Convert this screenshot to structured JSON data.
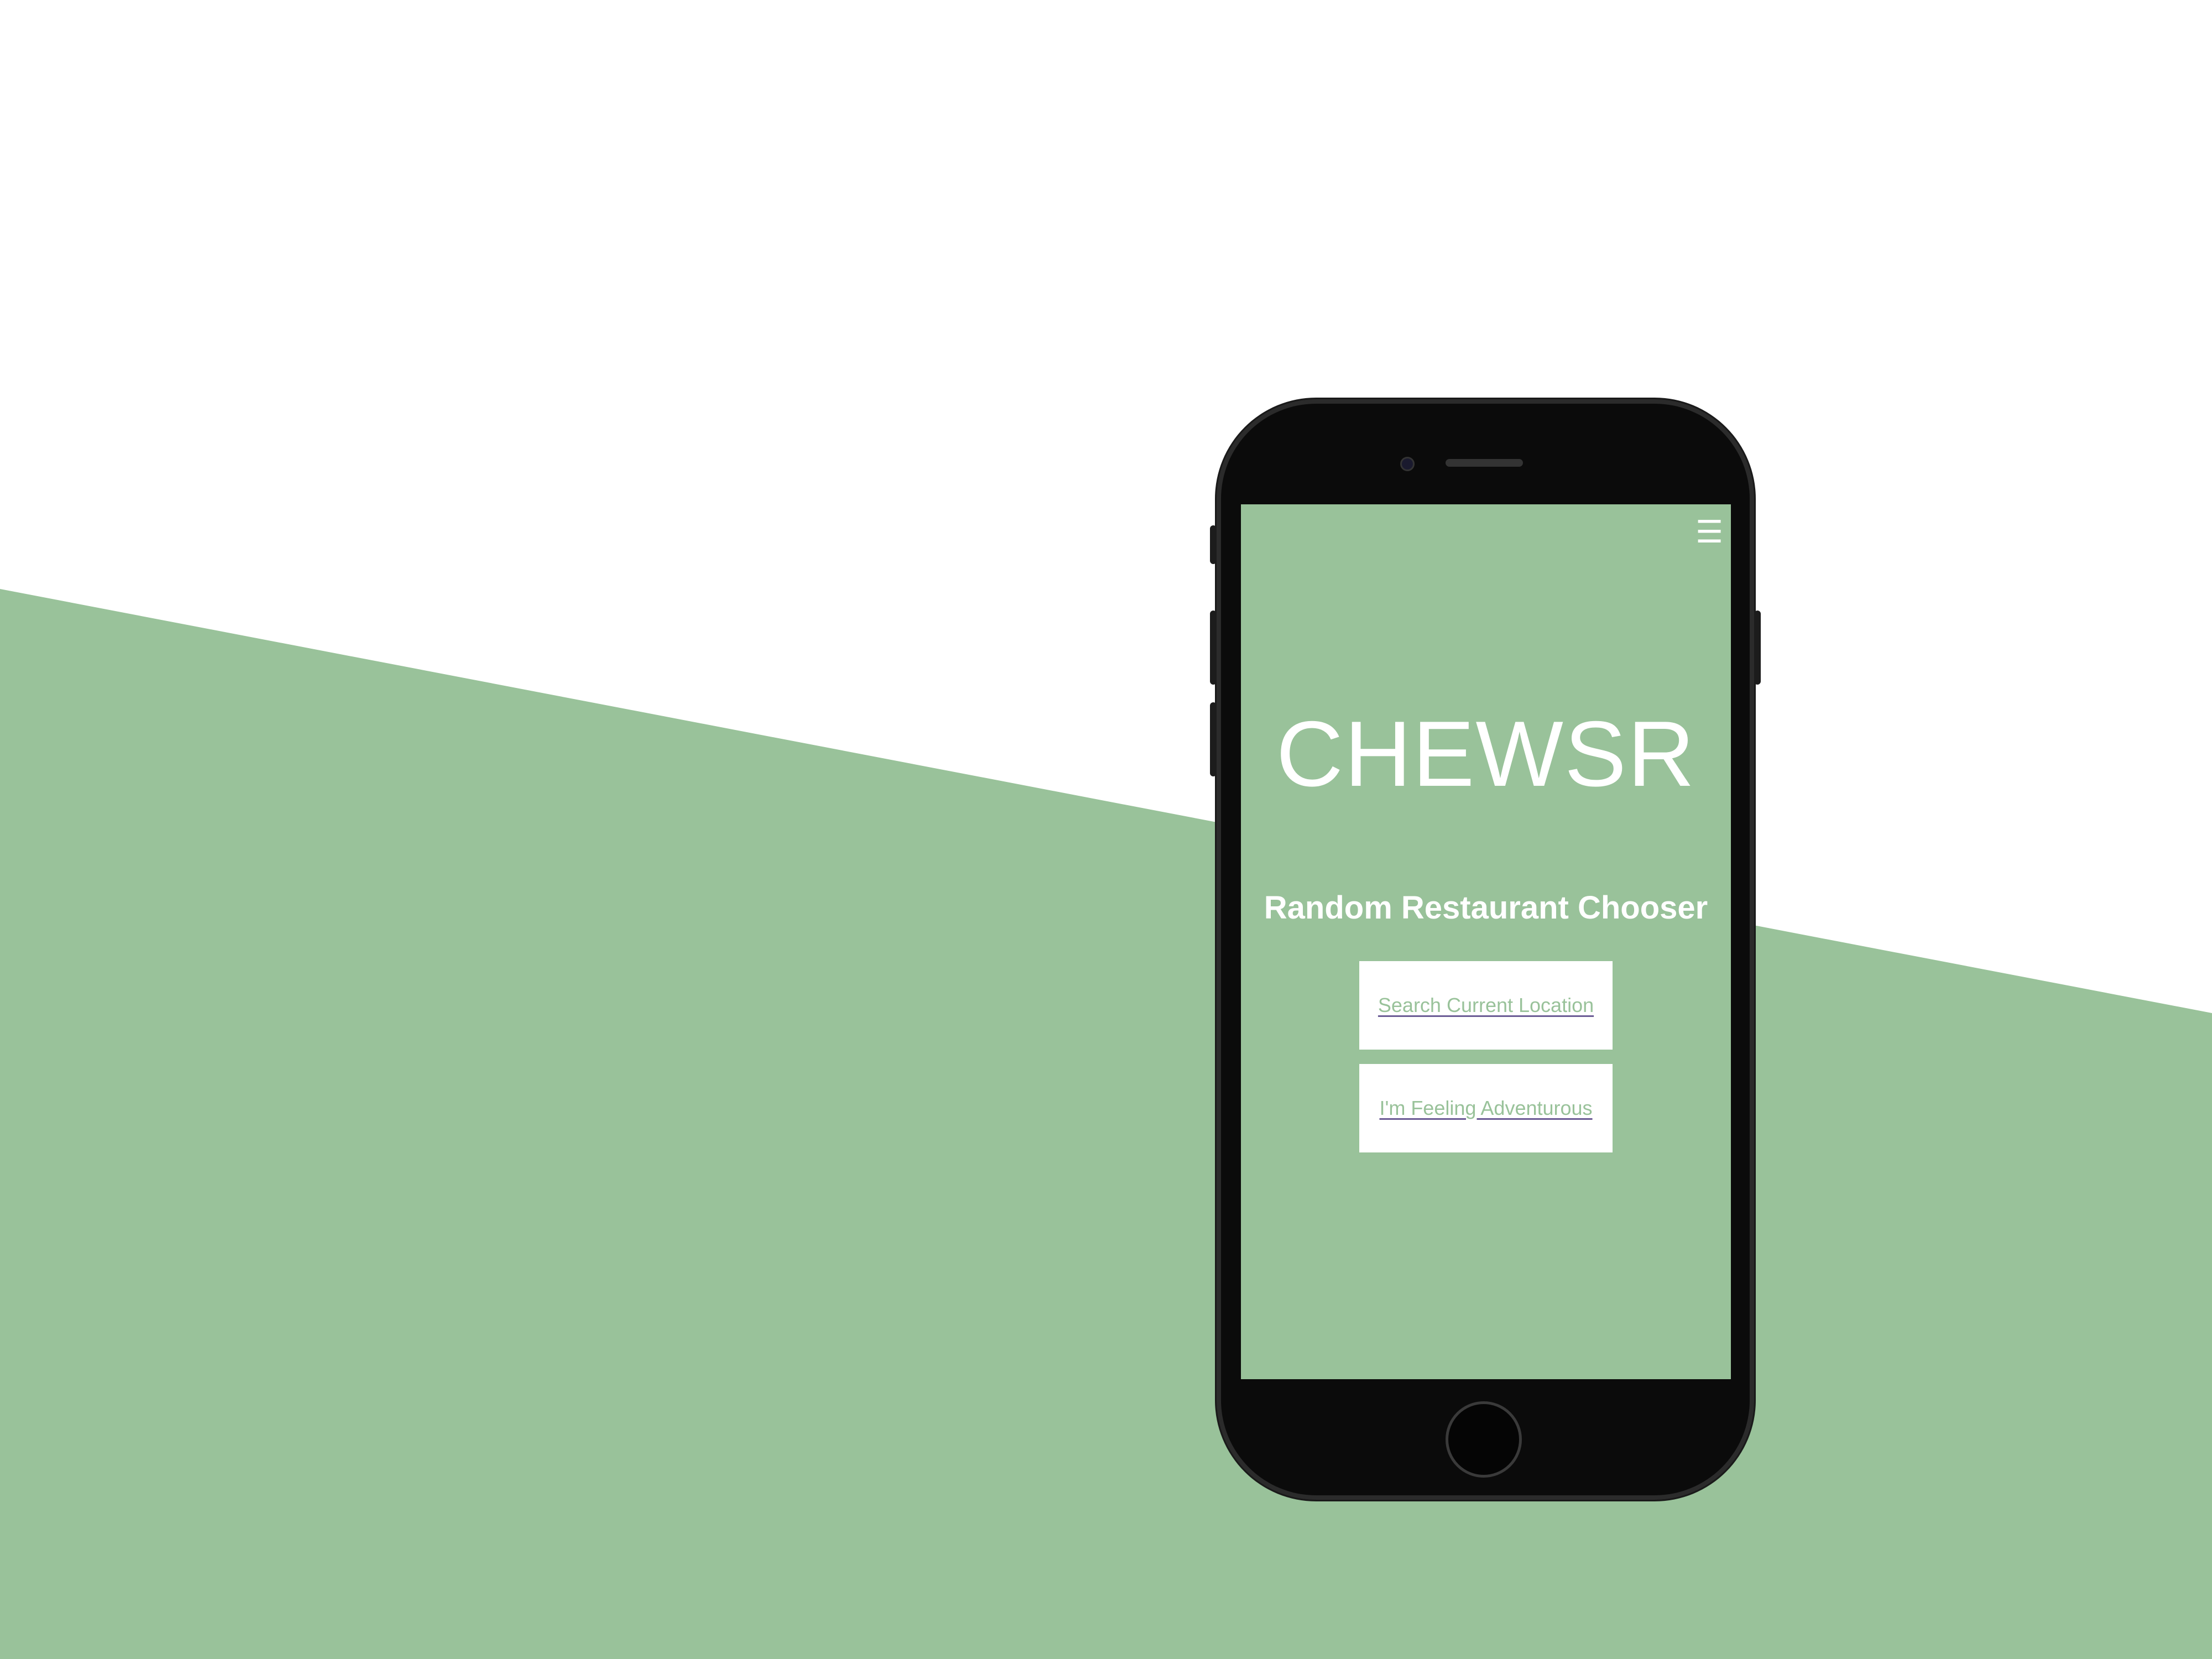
{
  "colors": {
    "background_white": "#ffffff",
    "accent_green": "#99c29a",
    "phone_body": "#0b0b0b",
    "button_white": "#ffffff",
    "underline_purple": "#6b5b95"
  },
  "app": {
    "menu_icon": "hamburger-menu-icon",
    "menu_glyph": "☰",
    "title": "CHEWSR",
    "subtitle": "Random Restaurant Chooser",
    "buttons": {
      "search_current_location": "Search Current Location",
      "feeling_adventurous": "I'm Feeling Adventurous"
    }
  }
}
